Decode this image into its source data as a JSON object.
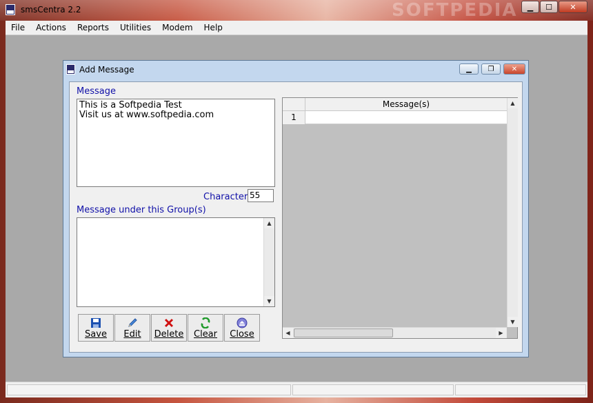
{
  "app": {
    "title": "smsCentra 2.2",
    "watermark": "SOFTPEDIA",
    "icon": "sms-icon",
    "controls": {
      "minimize": "▁",
      "maximize": "☐",
      "close": "✕"
    }
  },
  "menu": [
    "File",
    "Actions",
    "Reports",
    "Utilities",
    "Modem",
    "Help"
  ],
  "dialog": {
    "title": "Add Message",
    "controls": {
      "minimize": "▁",
      "restore": "❐",
      "close": "✕"
    },
    "message_label": "Message",
    "message_lines": [
      "This is a Softpedia Test",
      "Visit us at www.softpedia.com"
    ],
    "character_label": "Character",
    "character_count": "55",
    "group_label": "Message under this Group(s)",
    "buttons": [
      {
        "label": "Save",
        "icon": "floppy-disk-icon"
      },
      {
        "label": "Edit",
        "icon": "pencil-icon"
      },
      {
        "label": "Delete",
        "icon": "red-x-icon"
      },
      {
        "label": "Clear",
        "icon": "green-arrows-icon"
      },
      {
        "label": "Close",
        "icon": "eject-icon"
      }
    ],
    "grid": {
      "header": "Message(s)",
      "rows": [
        {
          "index": "1",
          "value": ""
        }
      ]
    }
  },
  "colors": {
    "label_blue": "#1010a8",
    "dialog_frame": "#c3d7ee"
  }
}
